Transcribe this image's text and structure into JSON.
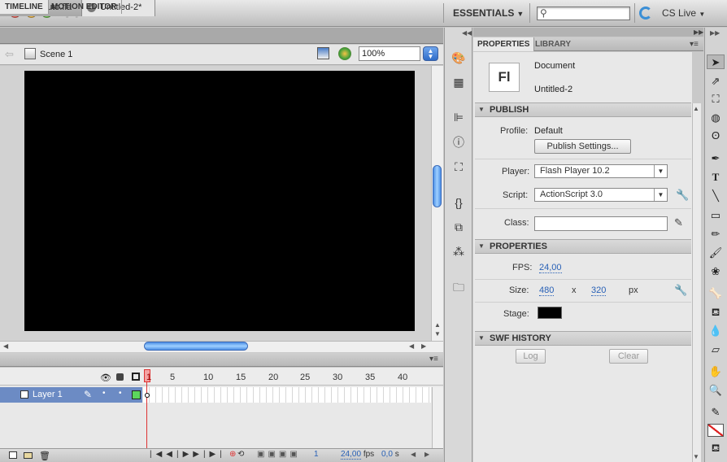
{
  "titlebar": {
    "app_logo": "Fl",
    "workspace": "ESSENTIALS",
    "search_placeholder": "",
    "cs_live": "CS Live"
  },
  "tabs": [
    {
      "label": "Flash_tuto.fla",
      "active": false
    },
    {
      "label": "Untitled-2*",
      "active": true
    }
  ],
  "editbar": {
    "scene": "Scene 1",
    "zoom": "100%"
  },
  "timeline": {
    "tabs": [
      "TIMELINE",
      "MOTION EDITOR"
    ],
    "frame_numbers": [
      "1",
      "5",
      "10",
      "15",
      "20",
      "25",
      "30",
      "35",
      "40"
    ],
    "layer": "Layer 1",
    "footer": {
      "current_frame": "1",
      "fps": "24,00",
      "fps_unit": "fps",
      "time": "0,0",
      "time_unit": "s"
    }
  },
  "properties": {
    "tabs": [
      "PROPERTIES",
      "LIBRARY"
    ],
    "doc_icon": "Fl",
    "doc_type": "Document",
    "doc_name": "Untitled-2",
    "publish": {
      "header": "PUBLISH",
      "profile_label": "Profile:",
      "profile_value": "Default",
      "settings_button": "Publish Settings...",
      "player_label": "Player:",
      "player_value": "Flash Player 10.2",
      "script_label": "Script:",
      "script_value": "ActionScript 3.0",
      "class_label": "Class:",
      "class_value": ""
    },
    "props": {
      "header": "PROPERTIES",
      "fps_label": "FPS:",
      "fps_value": "24,00",
      "size_label": "Size:",
      "width": "480",
      "x": "x",
      "height": "320",
      "unit": "px",
      "stage_label": "Stage:",
      "stage_color": "#000000"
    },
    "swf": {
      "header": "SWF HISTORY",
      "log": "Log",
      "clear": "Clear"
    }
  }
}
